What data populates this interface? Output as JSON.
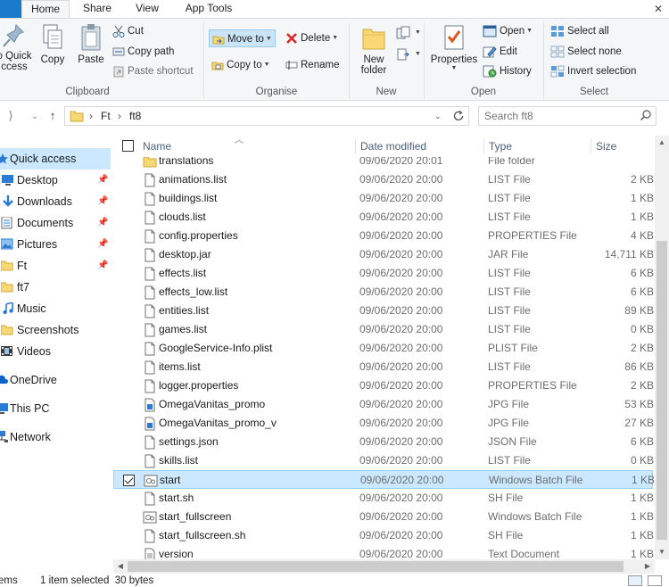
{
  "window": {
    "close_glyph": "✕"
  },
  "tabs": [
    {
      "label": "Home",
      "active": true
    },
    {
      "label": "Share",
      "active": false
    },
    {
      "label": "View",
      "active": false
    },
    {
      "label": "App Tools",
      "active": false
    }
  ],
  "ribbon": {
    "clipboard": {
      "label": "Clipboard",
      "pin_label_line1": "o Quick",
      "pin_label_line2": "ccess",
      "copy": "Copy",
      "paste": "Paste",
      "cut": "Cut",
      "copy_path": "Copy path",
      "paste_shortcut": "Paste shortcut"
    },
    "organise": {
      "label": "Organise",
      "move_to": "Move to",
      "copy_to": "Copy to",
      "delete": "Delete",
      "rename": "Rename"
    },
    "new": {
      "label": "New",
      "new_folder_line1": "New",
      "new_folder_line2": "folder"
    },
    "open": {
      "label": "Open",
      "properties": "Properties",
      "open": "Open",
      "edit": "Edit",
      "history": "History"
    },
    "select": {
      "label": "Select",
      "select_all": "Select all",
      "select_none": "Select none",
      "invert_selection": "Invert selection"
    }
  },
  "address": {
    "crumbs": [
      "Ft",
      "ft8"
    ],
    "search_placeholder": "Search ft8"
  },
  "sidebar": {
    "items": [
      {
        "label": "Quick access",
        "icon": "star-icon",
        "pinned": false,
        "selected": true
      },
      {
        "label": "Desktop",
        "icon": "desktop-icon",
        "pinned": true,
        "selected": false
      },
      {
        "label": "Downloads",
        "icon": "download-icon",
        "pinned": true,
        "selected": false
      },
      {
        "label": "Documents",
        "icon": "documents-icon",
        "pinned": true,
        "selected": false
      },
      {
        "label": "Pictures",
        "icon": "pictures-icon",
        "pinned": true,
        "selected": false
      },
      {
        "label": "Ft",
        "icon": "folder-icon",
        "pinned": true,
        "selected": false
      },
      {
        "label": "ft7",
        "icon": "folder-icon",
        "pinned": false,
        "selected": false
      },
      {
        "label": "Music",
        "icon": "music-icon",
        "pinned": false,
        "selected": false
      },
      {
        "label": "Screenshots",
        "icon": "folder-icon",
        "pinned": false,
        "selected": false
      },
      {
        "label": "Videos",
        "icon": "videos-icon",
        "pinned": false,
        "selected": false
      },
      {
        "label": "OneDrive",
        "icon": "cloud-icon",
        "pinned": false,
        "selected": false
      },
      {
        "label": "This PC",
        "icon": "computer-icon",
        "pinned": false,
        "selected": false
      },
      {
        "label": "Network",
        "icon": "network-icon",
        "pinned": false,
        "selected": false
      }
    ]
  },
  "columns": {
    "name": "Name",
    "date": "Date modified",
    "type": "Type",
    "size": "Size"
  },
  "files": [
    {
      "name": "translations",
      "date": "09/06/2020 20:01",
      "type": "File folder",
      "size": "",
      "icon": "folder-icon",
      "selected": false
    },
    {
      "name": "animations.list",
      "date": "09/06/2020 20:00",
      "type": "LIST File",
      "size": "2 KB",
      "icon": "file-icon",
      "selected": false
    },
    {
      "name": "buildings.list",
      "date": "09/06/2020 20:00",
      "type": "LIST File",
      "size": "1 KB",
      "icon": "file-icon",
      "selected": false
    },
    {
      "name": "clouds.list",
      "date": "09/06/2020 20:00",
      "type": "LIST File",
      "size": "1 KB",
      "icon": "file-icon",
      "selected": false
    },
    {
      "name": "config.properties",
      "date": "09/06/2020 20:00",
      "type": "PROPERTIES File",
      "size": "4 KB",
      "icon": "file-icon",
      "selected": false
    },
    {
      "name": "desktop.jar",
      "date": "09/06/2020 20:00",
      "type": "JAR File",
      "size": "14,711 KB",
      "icon": "file-icon",
      "selected": false
    },
    {
      "name": "effects.list",
      "date": "09/06/2020 20:00",
      "type": "LIST File",
      "size": "6 KB",
      "icon": "file-icon",
      "selected": false
    },
    {
      "name": "effects_low.list",
      "date": "09/06/2020 20:00",
      "type": "LIST File",
      "size": "6 KB",
      "icon": "file-icon",
      "selected": false
    },
    {
      "name": "entities.list",
      "date": "09/06/2020 20:00",
      "type": "LIST File",
      "size": "89 KB",
      "icon": "file-icon",
      "selected": false
    },
    {
      "name": "games.list",
      "date": "09/06/2020 20:00",
      "type": "LIST File",
      "size": "0 KB",
      "icon": "file-icon",
      "selected": false
    },
    {
      "name": "GoogleService-Info.plist",
      "date": "09/06/2020 20:00",
      "type": "PLIST File",
      "size": "2 KB",
      "icon": "file-icon",
      "selected": false
    },
    {
      "name": "items.list",
      "date": "09/06/2020 20:00",
      "type": "LIST File",
      "size": "86 KB",
      "icon": "file-icon",
      "selected": false
    },
    {
      "name": "logger.properties",
      "date": "09/06/2020 20:00",
      "type": "PROPERTIES File",
      "size": "2 KB",
      "icon": "file-icon",
      "selected": false
    },
    {
      "name": "OmegaVanitas_promo",
      "date": "09/06/2020 20:00",
      "type": "JPG File",
      "size": "53 KB",
      "icon": "image-file-icon",
      "selected": false
    },
    {
      "name": "OmegaVanitas_promo_v",
      "date": "09/06/2020 20:00",
      "type": "JPG File",
      "size": "27 KB",
      "icon": "image-file-icon",
      "selected": false
    },
    {
      "name": "settings.json",
      "date": "09/06/2020 20:00",
      "type": "JSON File",
      "size": "6 KB",
      "icon": "file-icon",
      "selected": false
    },
    {
      "name": "skills.list",
      "date": "09/06/2020 20:00",
      "type": "LIST File",
      "size": "0 KB",
      "icon": "file-icon",
      "selected": false
    },
    {
      "name": "start",
      "date": "09/06/2020 20:00",
      "type": "Windows Batch File",
      "size": "1 KB",
      "icon": "batch-file-icon",
      "selected": true
    },
    {
      "name": "start.sh",
      "date": "09/06/2020 20:00",
      "type": "SH File",
      "size": "1 KB",
      "icon": "file-icon",
      "selected": false
    },
    {
      "name": "start_fullscreen",
      "date": "09/06/2020 20:00",
      "type": "Windows Batch File",
      "size": "1 KB",
      "icon": "batch-file-icon",
      "selected": false
    },
    {
      "name": "start_fullscreen.sh",
      "date": "09/06/2020 20:00",
      "type": "SH File",
      "size": "1 KB",
      "icon": "file-icon",
      "selected": false
    },
    {
      "name": "version",
      "date": "09/06/2020 20:00",
      "type": "Text Document",
      "size": "1 KB",
      "icon": "text-file-icon",
      "selected": false
    }
  ],
  "status": {
    "items_count": "ems",
    "selection": "1 item selected  30 bytes"
  },
  "colors": {
    "accent": "#1979ca",
    "selection": "#cce8ff",
    "selection_border": "#99d1ff",
    "folder": "#f8d775"
  }
}
